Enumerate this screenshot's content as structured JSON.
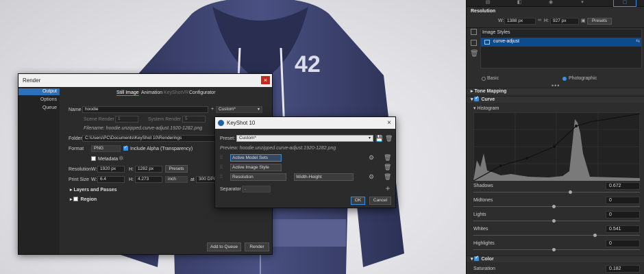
{
  "render_dialog": {
    "title": "Render",
    "close_label": "×",
    "nav": [
      "Output",
      "Options",
      "Queue"
    ],
    "tabs": [
      "Still Image",
      "Animation",
      "KeyShotVR",
      "Configurator"
    ],
    "name_label": "Name",
    "name_value": "hoodie",
    "plus_label": "+",
    "preset_value": "Custom*",
    "scene_render_label": "Scene Render #",
    "scene_render_value": "1",
    "system_render_label": "System Render #",
    "system_render_value": "5",
    "filename_preview": "Filename: hoodie.unzipped.curve-adjust.1920-1282.png",
    "folder_label": "Folder",
    "folder_value": "C:\\Users\\PC\\Documents\\KeyShot 10\\Renderings",
    "format_label": "Format",
    "format_value": "PNG",
    "include_alpha_label": "Include Alpha (Transparency)",
    "metadata_label": "Metadata",
    "resolution_label": "Resolution",
    "width_label": "W:",
    "width_value": "1920 px",
    "height_label": "H:",
    "height_value": "1282 px",
    "presets_label": "Presets",
    "print_size_label": "Print Size",
    "print_w_value": "6.4",
    "print_h_value": "4.273",
    "print_unit": "inch",
    "at_label": "at",
    "dpi_value": "300 DPI",
    "layers_label": "Layers and Passes",
    "region_label": "Region",
    "add_to_queue_label": "Add to Queue",
    "render_label": "Render"
  },
  "keyshot_dialog": {
    "title": "KeyShot 10",
    "close_label": "×",
    "preset_label": "Preset:",
    "preset_value": "Custom*",
    "preview": "Preview: hoodie.unzipped.curve-adjust.1920-1282.png",
    "rows": [
      {
        "field": "Active Model Sets",
        "extra": ""
      },
      {
        "field": "Active Image Style",
        "extra": ""
      },
      {
        "field": "Resolution",
        "extra": "Width-Height"
      }
    ],
    "separator_label": "Separator",
    "separator_value": ".",
    "ok_label": "OK",
    "cancel_label": "Cancel"
  },
  "panel": {
    "resolution_heading": "Resolution",
    "w_label": "W:",
    "w_value": "1388 px",
    "h_label": "H:",
    "h_value": "927 px",
    "presets_label": "Presets",
    "image_styles_label": "Image Styles",
    "style_item": "curve-adjust",
    "basic_label": "Basic",
    "photographic_label": "Photographic",
    "tone_mapping_label": "Tone Mapping",
    "curve_label": "Curve",
    "histogram_label": "Histogram",
    "sliders": [
      {
        "label": "Shadows",
        "value": "0.672",
        "pos": 0.58
      },
      {
        "label": "Midtones",
        "value": "0",
        "pos": 0.48
      },
      {
        "label": "Lights",
        "value": "0",
        "pos": 0.48
      },
      {
        "label": "Whites",
        "value": "0.541",
        "pos": 0.73
      },
      {
        "label": "Highlights",
        "value": "0",
        "pos": 0.48
      }
    ],
    "color_label": "Color",
    "saturation_label": "Saturation",
    "saturation_value": "0.182"
  },
  "colors": {
    "accent": "#3b8fe0",
    "panel_bg": "#2d2d2d",
    "close_red": "#c42b1c",
    "hoodie": "#3f4570"
  }
}
